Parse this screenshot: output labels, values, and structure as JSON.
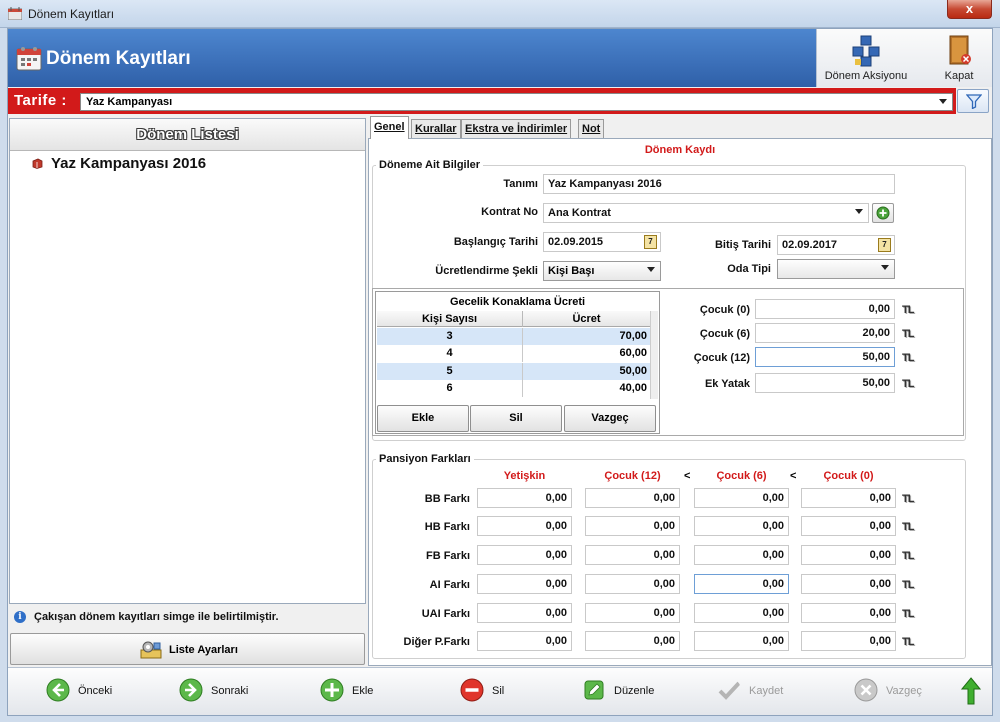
{
  "window": {
    "title": "Dönem Kayıtları",
    "close_glyph": "x"
  },
  "header": {
    "title": "Dönem Kayıtları",
    "actions": [
      {
        "label": "Dönem Aksiyonu",
        "icon": "period-action-icon"
      },
      {
        "label": "Kapat",
        "icon": "close-book-icon"
      }
    ]
  },
  "tarife": {
    "label": "Tarife :",
    "value": "Yaz Kampanyası"
  },
  "left": {
    "list_title": "Dönem Listesi",
    "items": [
      {
        "label": "Yaz Kampanyası 2016"
      }
    ],
    "info_text": "Çakışan dönem kayıtları simge ile belirtilmiştir.",
    "list_settings_label": "Liste Ayarları"
  },
  "tabs": [
    {
      "label": "Genel",
      "active": true
    },
    {
      "label": "Kurallar",
      "active": false
    },
    {
      "label": "Ekstra ve İndirimler",
      "active": false
    },
    {
      "label": "Not",
      "active": false
    }
  ],
  "form": {
    "section_title": "Dönem Kaydı",
    "group_title": "Döneme Ait Bilgiler",
    "name_label": "Tanımı",
    "name_value": "Yaz Kampanyası 2016",
    "contract_label": "Kontrat No",
    "contract_value": "Ana Kontrat",
    "start_label": "Başlangıç Tarihi",
    "start_value": "02.09.2015",
    "end_label": "Bitiş Tarihi",
    "end_value": "02.09.2017",
    "pricing_label": "Ücretlendirme Şekli",
    "pricing_value": "Kişi Başı",
    "room_label": "Oda Tipi",
    "room_value": "",
    "calendar_glyph": "7"
  },
  "nightly": {
    "title": "Gecelik Konaklama Ücreti",
    "col_persons": "Kişi Sayısı",
    "col_price": "Ücret",
    "rows": [
      {
        "persons": "3",
        "price": "70,00"
      },
      {
        "persons": "4",
        "price": "60,00"
      },
      {
        "persons": "5",
        "price": "50,00"
      },
      {
        "persons": "6",
        "price": "40,00"
      }
    ],
    "buttons": {
      "add": "Ekle",
      "delete": "Sil",
      "cancel": "Vazgeç"
    }
  },
  "children": [
    {
      "label": "Çocuk (0)",
      "value": "0,00"
    },
    {
      "label": "Çocuk (6)",
      "value": "20,00"
    },
    {
      "label": "Çocuk (12)",
      "value": "50,00"
    },
    {
      "label": "Ek Yatak",
      "value": "50,00"
    }
  ],
  "currency": "TL",
  "pension": {
    "group_title": "Pansiyon Farkları",
    "columns": [
      "Yetişkin",
      "Çocuk (12)",
      "Çocuk (6)",
      "Çocuk (0)"
    ],
    "lt": "<",
    "rows": [
      {
        "label": "BB Farkı",
        "values": [
          "0,00",
          "0,00",
          "0,00",
          "0,00"
        ]
      },
      {
        "label": "HB Farkı",
        "values": [
          "0,00",
          "0,00",
          "0,00",
          "0,00"
        ]
      },
      {
        "label": "FB Farkı",
        "values": [
          "0,00",
          "0,00",
          "0,00",
          "0,00"
        ]
      },
      {
        "label": "AI Farkı",
        "values": [
          "0,00",
          "0,00",
          "0,00",
          "0,00"
        ]
      },
      {
        "label": "UAI Farkı",
        "values": [
          "0,00",
          "0,00",
          "0,00",
          "0,00"
        ]
      },
      {
        "label": "Diğer P.Farkı",
        "values": [
          "0,00",
          "0,00",
          "0,00",
          "0,00"
        ]
      }
    ]
  },
  "toolbar": {
    "prev": "Önceki",
    "next": "Sonraki",
    "add": "Ekle",
    "delete": "Sil",
    "edit": "Düzenle",
    "save": "Kaydet",
    "cancel": "Vazgeç"
  },
  "colors": {
    "header_blue": "#3b6fb8",
    "tarife_red": "#d21a1a",
    "row_highlight": "#d6e6f8"
  }
}
